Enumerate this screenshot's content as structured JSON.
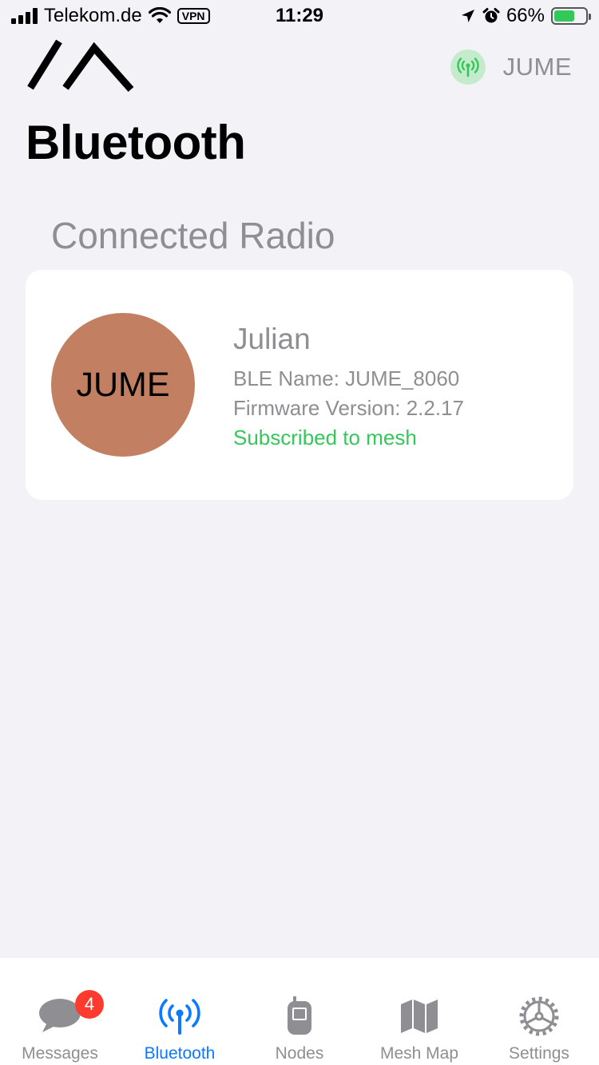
{
  "status_bar": {
    "carrier": "Telekom.de",
    "vpn": "VPN",
    "time": "11:29",
    "battery_percent": "66%",
    "battery_level": 0.66
  },
  "header": {
    "title": "Bluetooth",
    "connected_short_name": "JUME"
  },
  "section": {
    "title": "Connected Radio"
  },
  "radio": {
    "avatar_text": "JUME",
    "avatar_color": "#c27f62",
    "long_name": "Julian",
    "ble_name": "BLE Name: JUME_8060",
    "firmware": "Firmware Version: 2.2.17",
    "status": "Subscribed to mesh",
    "status_color": "#34c759"
  },
  "tabs": [
    {
      "label": "Messages",
      "icon": "chat-bubble-icon",
      "badge": "4",
      "active": false
    },
    {
      "label": "Bluetooth",
      "icon": "antenna-icon",
      "active": true
    },
    {
      "label": "Nodes",
      "icon": "radio-device-icon",
      "active": false
    },
    {
      "label": "Mesh Map",
      "icon": "map-icon",
      "active": false
    },
    {
      "label": "Settings",
      "icon": "gear-icon",
      "active": false
    }
  ],
  "colors": {
    "accent": "#0a7aff",
    "background": "#f2f2f7",
    "badge": "#ff3b30"
  }
}
